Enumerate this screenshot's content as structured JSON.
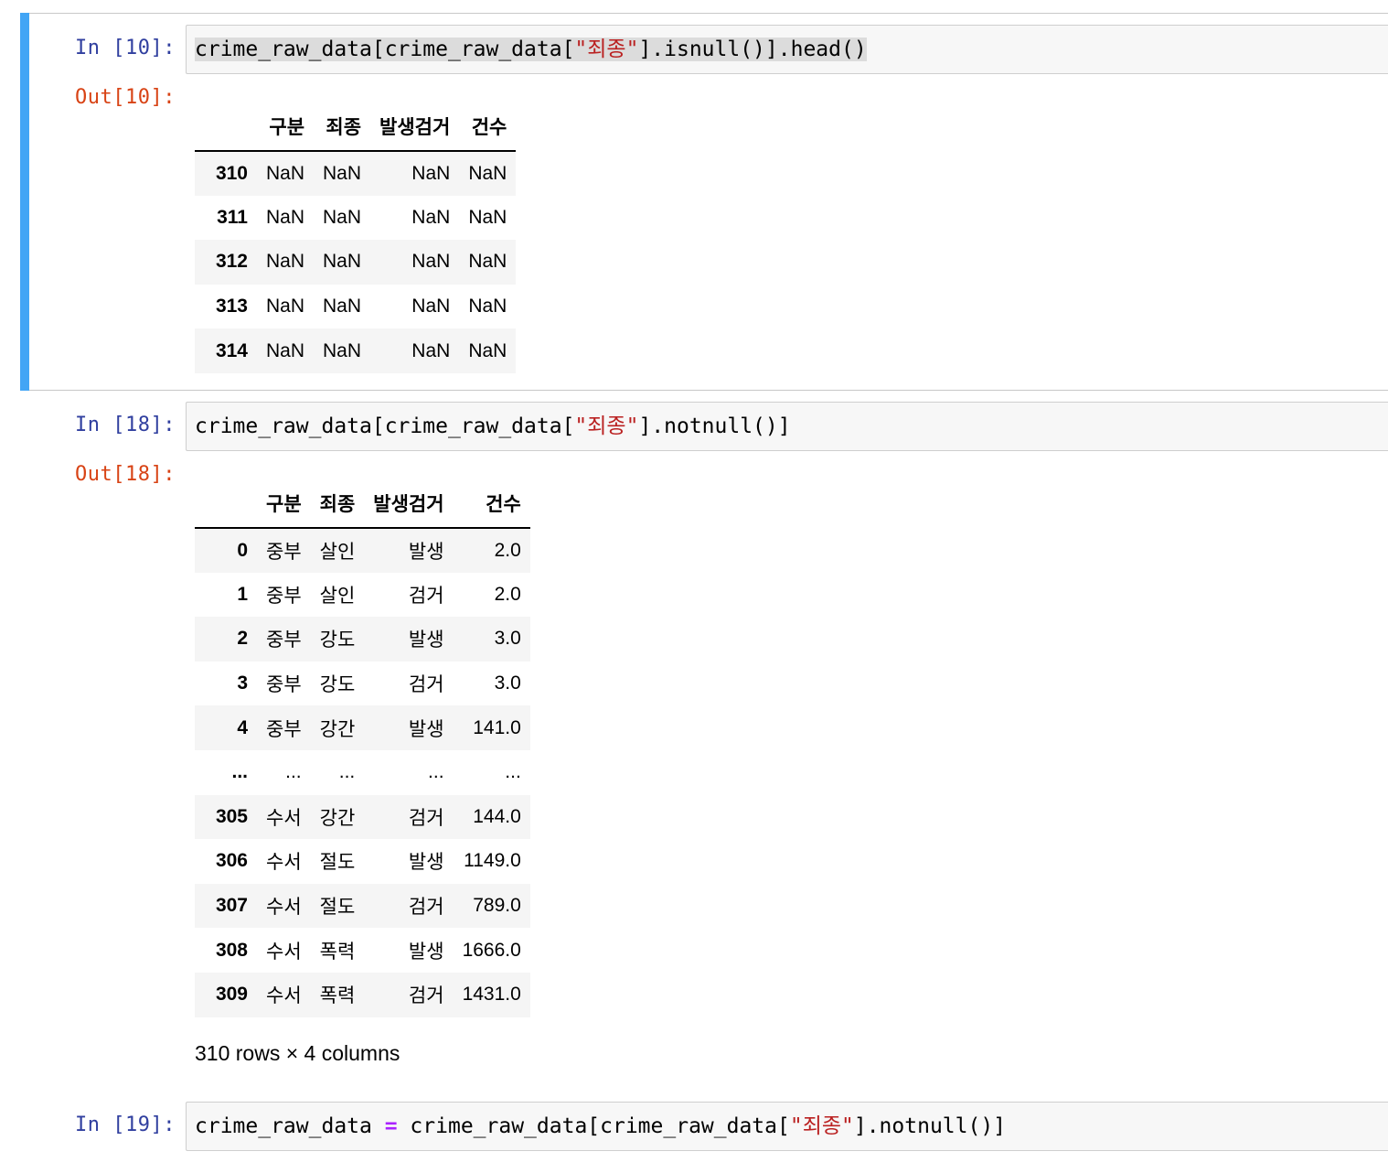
{
  "cells": [
    {
      "in_prompt": "In [10]:",
      "code": {
        "a": "crime_raw_data[crime_raw_data[",
        "s": "\"죄종\"",
        "b": "].isnull()].head()"
      },
      "out_prompt": "Out[10]:",
      "table": {
        "columns": [
          "구분",
          "죄종",
          "발생검거",
          "건수"
        ],
        "rows": [
          {
            "idx": "310",
            "v": [
              "NaN",
              "NaN",
              "NaN",
              "NaN"
            ]
          },
          {
            "idx": "311",
            "v": [
              "NaN",
              "NaN",
              "NaN",
              "NaN"
            ]
          },
          {
            "idx": "312",
            "v": [
              "NaN",
              "NaN",
              "NaN",
              "NaN"
            ]
          },
          {
            "idx": "313",
            "v": [
              "NaN",
              "NaN",
              "NaN",
              "NaN"
            ]
          },
          {
            "idx": "314",
            "v": [
              "NaN",
              "NaN",
              "NaN",
              "NaN"
            ]
          }
        ]
      }
    },
    {
      "in_prompt": "In [18]:",
      "code": {
        "a": "crime_raw_data[crime_raw_data[",
        "s": "\"죄종\"",
        "b": "].notnull()]"
      },
      "out_prompt": "Out[18]:",
      "table": {
        "columns": [
          "구분",
          "죄종",
          "발생검거",
          "건수"
        ],
        "rows": [
          {
            "idx": "0",
            "v": [
              "중부",
              "살인",
              "발생",
              "2.0"
            ]
          },
          {
            "idx": "1",
            "v": [
              "중부",
              "살인",
              "검거",
              "2.0"
            ]
          },
          {
            "idx": "2",
            "v": [
              "중부",
              "강도",
              "발생",
              "3.0"
            ]
          },
          {
            "idx": "3",
            "v": [
              "중부",
              "강도",
              "검거",
              "3.0"
            ]
          },
          {
            "idx": "4",
            "v": [
              "중부",
              "강간",
              "발생",
              "141.0"
            ]
          },
          {
            "idx": "...",
            "v": [
              "...",
              "...",
              "...",
              "..."
            ]
          },
          {
            "idx": "305",
            "v": [
              "수서",
              "강간",
              "검거",
              "144.0"
            ]
          },
          {
            "idx": "306",
            "v": [
              "수서",
              "절도",
              "발생",
              "1149.0"
            ]
          },
          {
            "idx": "307",
            "v": [
              "수서",
              "절도",
              "검거",
              "789.0"
            ]
          },
          {
            "idx": "308",
            "v": [
              "수서",
              "폭력",
              "발생",
              "1666.0"
            ]
          },
          {
            "idx": "309",
            "v": [
              "수서",
              "폭력",
              "검거",
              "1431.0"
            ]
          }
        ]
      },
      "rows_info": "310 rows × 4 columns"
    },
    {
      "in_prompt": "In [19]:",
      "code": {
        "a": "crime_raw_data ",
        "op": "=",
        "b2": " crime_raw_data[crime_raw_data[",
        "s": "\"죄종\"",
        "b": "].notnull()]"
      }
    }
  ]
}
